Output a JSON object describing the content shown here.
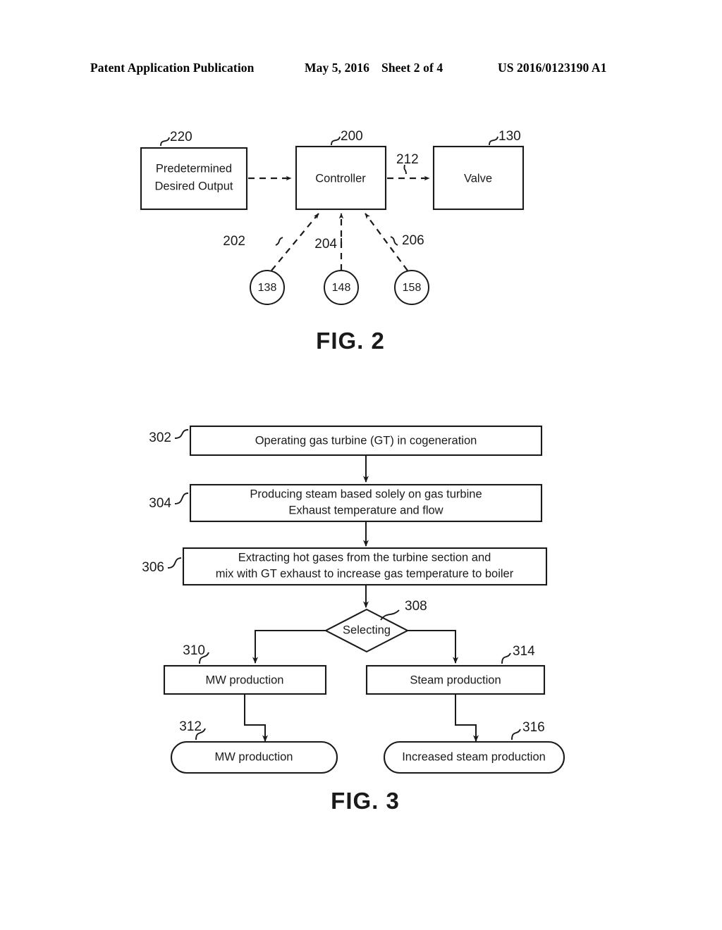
{
  "header": {
    "publication": "Patent Application Publication",
    "date": "May 5, 2016",
    "sheet": "Sheet 2 of 4",
    "patent_number": "US 2016/0123190 A1"
  },
  "figures": [
    {
      "caption": "FIG. 2",
      "type": "block-diagram",
      "nodes": [
        {
          "ref": "220",
          "label_line1": "Predetermined",
          "label_line2": "Desired Output",
          "shape": "rectangle"
        },
        {
          "ref": "200",
          "label_line1": "Controller",
          "label_line2": "",
          "shape": "rectangle"
        },
        {
          "ref": "130",
          "label_line1": "Valve",
          "label_line2": "",
          "shape": "rectangle"
        }
      ],
      "sensors": [
        {
          "ref": "202",
          "value": "138",
          "shape": "circle"
        },
        {
          "ref": "204",
          "value": "148",
          "shape": "circle"
        },
        {
          "ref": "206",
          "value": "158",
          "shape": "circle"
        }
      ],
      "connections": [
        {
          "ref": "",
          "from": "220",
          "to": "200",
          "style": "dashed"
        },
        {
          "ref": "212",
          "from": "200",
          "to": "130",
          "style": "dashed"
        },
        {
          "ref": "202",
          "from": "138",
          "to": "200",
          "style": "dashed"
        },
        {
          "ref": "204",
          "from": "148",
          "to": "200",
          "style": "dashed"
        },
        {
          "ref": "206",
          "from": "158",
          "to": "200",
          "style": "dashed"
        }
      ]
    },
    {
      "caption": "FIG. 3",
      "type": "flowchart",
      "steps": [
        {
          "ref": "302",
          "shape": "rectangle",
          "line1": "Operating gas turbine (GT) in cogeneration",
          "line2": ""
        },
        {
          "ref": "304",
          "shape": "rectangle",
          "line1": "Producing steam based solely on gas turbine",
          "line2": "Exhaust temperature and flow"
        },
        {
          "ref": "306",
          "shape": "rectangle",
          "line1": "Extracting hot gases from the turbine section and",
          "line2": "mix with GT exhaust to increase gas temperature to boiler"
        },
        {
          "ref": "308",
          "shape": "diamond",
          "line1": "Selecting",
          "line2": ""
        },
        {
          "ref": "310",
          "shape": "rectangle",
          "line1": "MW production",
          "line2": ""
        },
        {
          "ref": "314",
          "shape": "rectangle",
          "line1": "Steam production",
          "line2": ""
        },
        {
          "ref": "312",
          "shape": "rounded",
          "line1": "MW production",
          "line2": ""
        },
        {
          "ref": "316",
          "shape": "rounded",
          "line1": "Increased steam production",
          "line2": ""
        }
      ]
    }
  ]
}
